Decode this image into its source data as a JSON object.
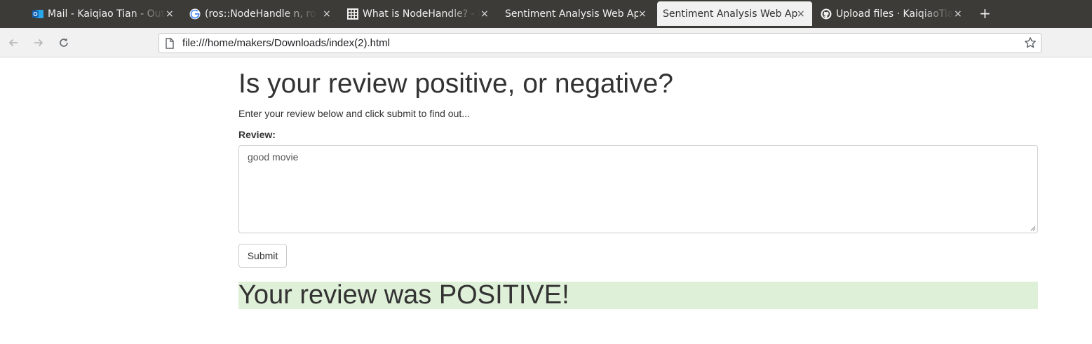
{
  "browser": {
    "tabs": [
      {
        "title": "Mail - Kaiqiao Tian - Outlook",
        "icon": "outlook-icon",
        "active": false
      },
      {
        "title": "(ros::NodeHandle n, ros::NodeHandle",
        "icon": "google-icon",
        "active": false
      },
      {
        "title": "What is NodeHandle? - ROS Answers",
        "icon": "ros-answers-icon",
        "active": false
      },
      {
        "title": "Sentiment Analysis Web App",
        "icon": "none",
        "active": false
      },
      {
        "title": "Sentiment Analysis Web App",
        "icon": "none",
        "active": true
      },
      {
        "title": "Upload files · KaiqiaoTian",
        "icon": "github-icon",
        "active": false
      }
    ],
    "close_glyph": "×",
    "new_tab_glyph": "+",
    "url": "file:///home/makers/Downloads/index(2).html"
  },
  "page": {
    "heading": "Is your review positive, or negative?",
    "lead": "Enter your review below and click submit to find out...",
    "review_label": "Review:",
    "review_value": "good movie",
    "submit_label": "Submit",
    "result_text": "Your review was POSITIVE!",
    "result_color": "#dff0d8"
  }
}
